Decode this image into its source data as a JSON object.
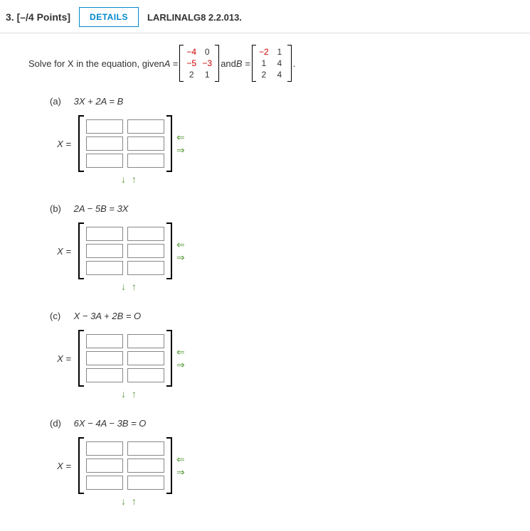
{
  "header": {
    "question_label": "3. [–/4 Points]",
    "details_label": "DETAILS",
    "qid": "LARLINALG8 2.2.013."
  },
  "prompt": {
    "lead": "Solve for X in the equation, given ",
    "A_label": "A = ",
    "and_label": " and ",
    "B_label": "B = ",
    "period": "."
  },
  "matrixA": [
    [
      "−4",
      "0"
    ],
    [
      "−5",
      "−3"
    ],
    [
      "2",
      "1"
    ]
  ],
  "matrixB": [
    [
      "−2",
      "1"
    ],
    [
      "1",
      "4"
    ],
    [
      "2",
      "4"
    ]
  ],
  "parts": [
    {
      "letter": "(a)",
      "equation": "3X + 2A = B"
    },
    {
      "letter": "(b)",
      "equation": "2A − 5B = 3X"
    },
    {
      "letter": "(c)",
      "equation": "X − 3A + 2B = O"
    },
    {
      "letter": "(d)",
      "equation": "6X − 4A − 3B = O"
    }
  ],
  "labels": {
    "x_equals": "X = "
  },
  "arrows": {
    "left": "⇐",
    "right": "⇒",
    "down": "↓",
    "up": "↑"
  }
}
